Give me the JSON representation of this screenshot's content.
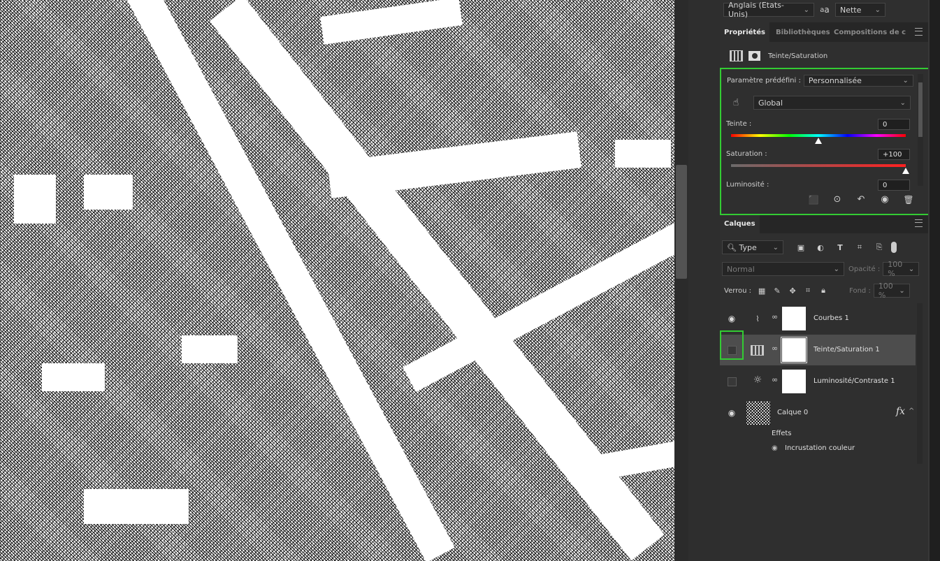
{
  "canvas": {
    "description_icon": "aerial-map-image"
  },
  "top_bar": {
    "language": "Anglais (Etats-Unis)",
    "aa_icon": "anti-alias-icon",
    "aa_label": "a",
    "aa_sub": "a",
    "sharpness": "Nette"
  },
  "tabs": {
    "properties": "Propriétés",
    "libraries": "Bibliothèques",
    "compositions": "Compositions de c"
  },
  "properties": {
    "adjustment_title": "Teinte/Saturation",
    "preset_label": "Paramètre prédéfini :",
    "preset_value": "Personnalisée",
    "channel_value": "Global",
    "hue_label": "Teinte :",
    "hue_value": "0",
    "hue_level": 0.5,
    "saturation_label": "Saturation :",
    "saturation_value": "+100",
    "saturation_level": 1.0,
    "lightness_label": "Luminosité :",
    "lightness_value": "0"
  },
  "layers_panel": {
    "tab": "Calques",
    "filter_type": "Type",
    "blend_mode": "Normal",
    "opacity_label": "Opacité :",
    "opacity_value": "100 %",
    "lock_label": "Verrou :",
    "fill_label": "Fond :",
    "fill_value": "100 %",
    "layers": [
      {
        "name": "Courbes 1",
        "visible": true,
        "icon": "curves-icon"
      },
      {
        "name": "Teinte/Saturation 1",
        "visible": false,
        "icon": "hue-saturation-icon",
        "selected": true
      },
      {
        "name": "Luminosité/Contraste 1",
        "visible": false,
        "icon": "brightness-contrast-icon"
      },
      {
        "name": "Calque 0",
        "visible": true,
        "icon": "image-thumbnail"
      }
    ],
    "fx_label": "fx",
    "effects_label": "Effets",
    "effect_item": "Incrustation couleur"
  },
  "colors": {
    "highlight": "#33cc33",
    "panel_bg": "#2f2f2f"
  }
}
